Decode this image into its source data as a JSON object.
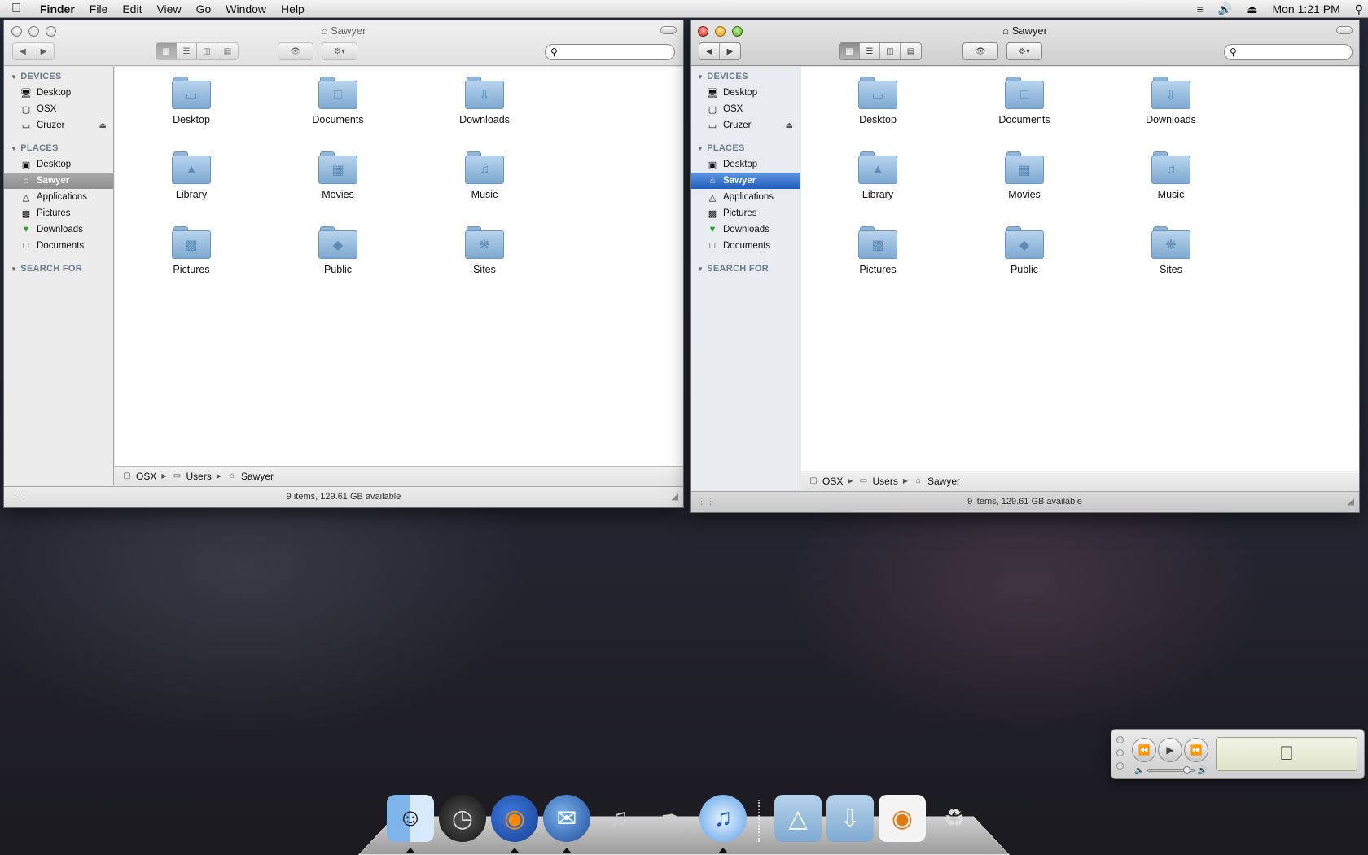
{
  "menubar": {
    "apple": "",
    "items": [
      "Finder",
      "File",
      "Edit",
      "View",
      "Go",
      "Window",
      "Help"
    ],
    "clock": "Mon 1:21 PM"
  },
  "windows": [
    {
      "id": "left",
      "state": "inactive",
      "title": "Sawyer",
      "search_placeholder": "",
      "sidebar": {
        "devices_label": "DEVICES",
        "devices": [
          "Desktop",
          "OSX",
          "Cruzer"
        ],
        "places_label": "PLACES",
        "places": [
          "Desktop",
          "Sawyer",
          "Applications",
          "Pictures",
          "Downloads",
          "Documents"
        ],
        "selected": "Sawyer",
        "search_label": "SEARCH FOR"
      },
      "items": [
        "Desktop",
        "Documents",
        "Downloads",
        "Library",
        "Movies",
        "Music",
        "Pictures",
        "Public",
        "Sites"
      ],
      "path": [
        "OSX",
        "Users",
        "Sawyer"
      ],
      "status": "9 items, 129.61 GB available"
    },
    {
      "id": "right",
      "state": "active",
      "title": "Sawyer",
      "search_placeholder": "",
      "sidebar": {
        "devices_label": "DEVICES",
        "devices": [
          "Desktop",
          "OSX",
          "Cruzer"
        ],
        "places_label": "PLACES",
        "places": [
          "Desktop",
          "Sawyer",
          "Applications",
          "Pictures",
          "Downloads",
          "Documents"
        ],
        "selected": "Sawyer",
        "search_label": "SEARCH FOR"
      },
      "items": [
        "Desktop",
        "Documents",
        "Downloads",
        "Library",
        "Movies",
        "Music",
        "Pictures",
        "Public",
        "Sites"
      ],
      "path": [
        "OSX",
        "Users",
        "Sawyer"
      ],
      "status": "9 items, 129.61 GB available"
    }
  ],
  "colors": {
    "selection_active": "#1f5fbf",
    "selection_inactive": "#8f8f8f",
    "folder": "#7ea9d1"
  },
  "dock": {
    "apps": [
      "finder-icon",
      "dashboard-icon",
      "firefox-icon",
      "thunderbird-icon",
      "headphones-icon",
      "script-editor-icon",
      "itunes-icon"
    ],
    "stack": [
      "applications-stack-icon",
      "downloads-stack-icon",
      "firefox-doc-icon",
      "trash-icon"
    ]
  }
}
